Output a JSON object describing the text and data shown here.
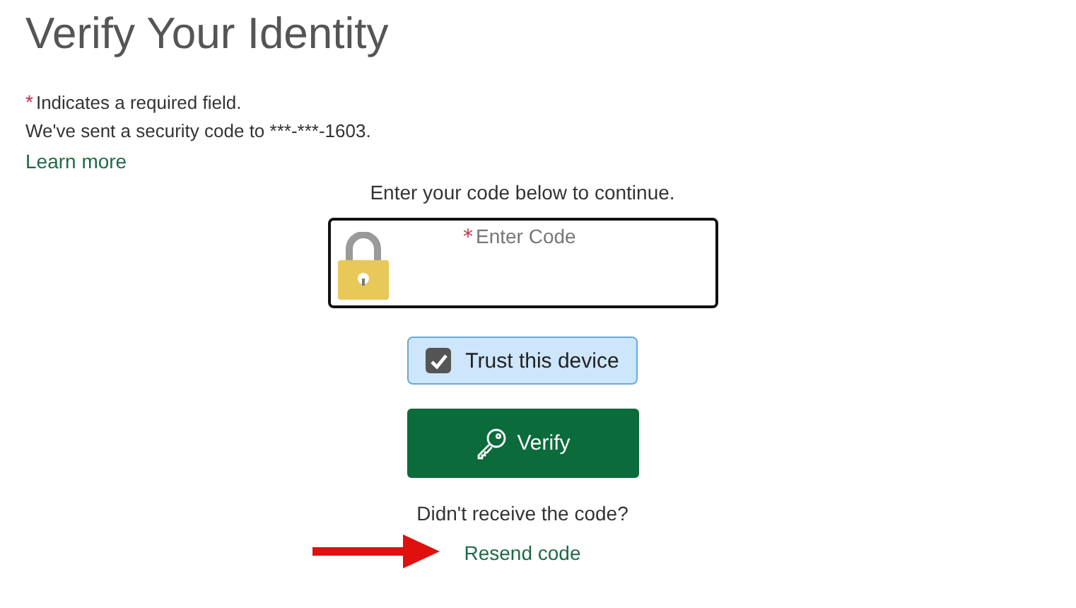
{
  "title": "Verify Your Identity",
  "required_note": {
    "mark": "*",
    "text": "Indicates a required field."
  },
  "sent_message": "We've sent a security code to ***-***-1603.",
  "learn_more": "Learn more",
  "instruction": "Enter your code below to continue.",
  "code_field": {
    "mark": "*",
    "placeholder": "Enter Code"
  },
  "trust_device": {
    "label": "Trust this device",
    "checked": true
  },
  "verify_button": "Verify",
  "resend_prompt": "Didn't receive the code?",
  "resend_link": "Resend code"
}
